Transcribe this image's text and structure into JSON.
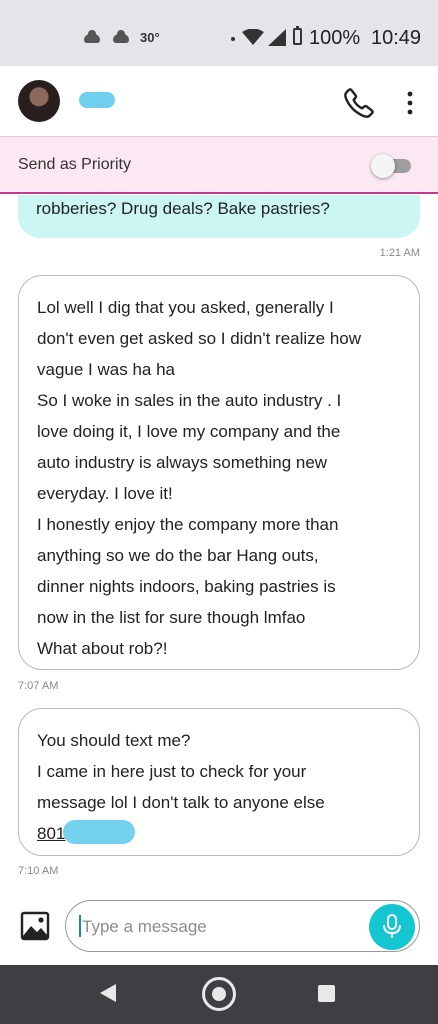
{
  "status_bar": {
    "weather_icons": [
      "cloud-icon",
      "cloud-icon"
    ],
    "temperature": "30°",
    "battery": "100%",
    "time": "10:49"
  },
  "header": {
    "contact_name": "",
    "icons": [
      "phone-icon",
      "more-vert-icon"
    ]
  },
  "priority": {
    "label": "Send as Priority",
    "enabled": false
  },
  "messages": [
    {
      "direction": "outgoing",
      "lines": [
        "robberies? Drug deals? Bake pastries?"
      ],
      "time": "1:21 AM"
    },
    {
      "direction": "incoming",
      "lines": [
        "Lol well I dig that you asked, generally I",
        "don't even get asked so I didn't realize how",
        "vague I was ha ha",
        "So I woke in sales in the auto industry . I",
        "love doing it, I love my company and the",
        "auto industry is always something new",
        "everyday. I love it!",
        "I honestly enjoy the company more than",
        "anything so we do the bar Hang outs,",
        "dinner nights indoors, baking pastries is",
        "now in the list for sure though lmfao",
        "What about rob?!"
      ],
      "time": "7:07 AM"
    },
    {
      "direction": "incoming",
      "lines": [
        "You should text me?",
        "I came in here just to check for your",
        "message lol I don't talk to anyone else"
      ],
      "phone_prefix": "801",
      "time": "7:10 AM"
    }
  ],
  "composer": {
    "placeholder": "Type a message",
    "value": ""
  },
  "colors": {
    "accent": "#14c6cf",
    "priority_bg": "#fce8f3",
    "priority_border": "#c23a8f",
    "outgoing_bubble": "#cbf6f4",
    "redaction": "#6ed0ee"
  }
}
